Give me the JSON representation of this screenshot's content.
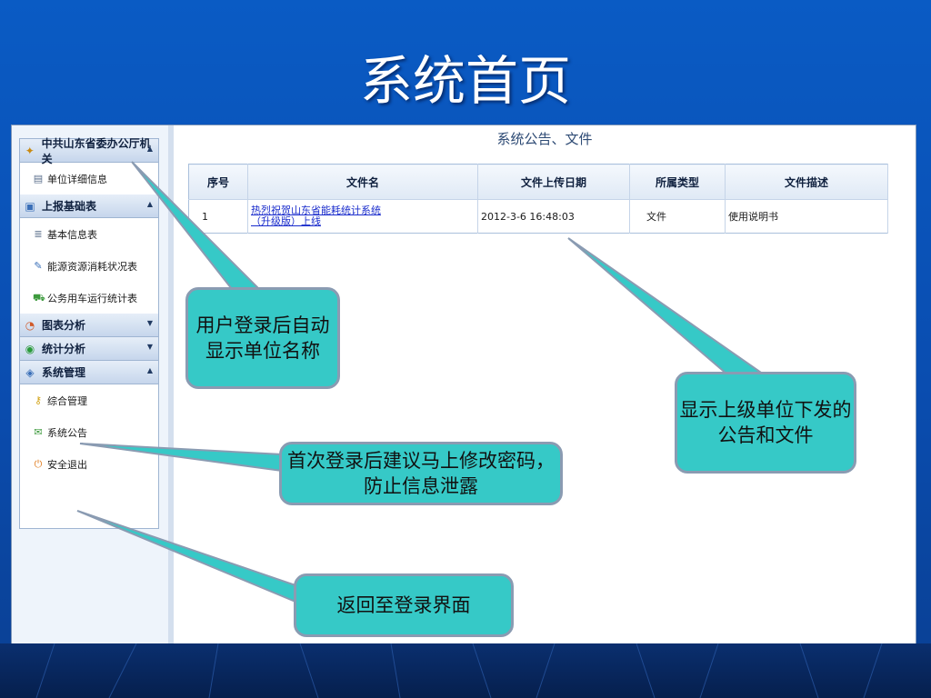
{
  "slide": {
    "title": "系统首页"
  },
  "sidebar": {
    "groups": [
      {
        "label": "中共山东省委办公厅机关",
        "icon": "org-icon",
        "expanded": true,
        "items": [
          {
            "label": "单位详细信息",
            "icon": "detail-icon"
          }
        ]
      },
      {
        "label": "上报基础表",
        "icon": "clipboard-icon",
        "expanded": true,
        "items": [
          {
            "label": "基本信息表",
            "icon": "list-icon"
          },
          {
            "label": "能源资源消耗状况表",
            "icon": "edit-icon"
          },
          {
            "label": "公务用车运行统计表",
            "icon": "car-icon"
          }
        ]
      },
      {
        "label": "图表分析",
        "icon": "pie-chart-icon",
        "expanded": false,
        "items": []
      },
      {
        "label": "统计分析",
        "icon": "stats-icon",
        "expanded": false,
        "items": []
      },
      {
        "label": "系统管理",
        "icon": "settings-icon",
        "expanded": true,
        "items": [
          {
            "label": "综合管理",
            "icon": "key-icon"
          },
          {
            "label": "系统公告",
            "icon": "announcement-icon"
          },
          {
            "label": "安全退出",
            "icon": "logout-icon"
          }
        ]
      }
    ]
  },
  "main": {
    "panel_title": "系统公告、文件",
    "table": {
      "headers": [
        "序号",
        "文件名",
        "文件上传日期",
        "所属类型",
        "文件描述"
      ],
      "rows": [
        {
          "index": "1",
          "name_line1": "热烈祝贺山东省能耗统计系统",
          "name_line2": "（升级版）上线",
          "date": "2012-3-6 16:48:03",
          "type": "文件",
          "desc": "使用说明书"
        }
      ]
    }
  },
  "callouts": {
    "unit_name": "用户登录后自动显示单位名称",
    "notices": "显示上级单位下发的公告和文件",
    "password": "首次登录后建议马上修改密码，防止信息泄露",
    "logout": "返回至登录界面"
  },
  "colors": {
    "background": "#0a4db0",
    "callout": "#36c9c7",
    "link": "#1a2ccc"
  }
}
